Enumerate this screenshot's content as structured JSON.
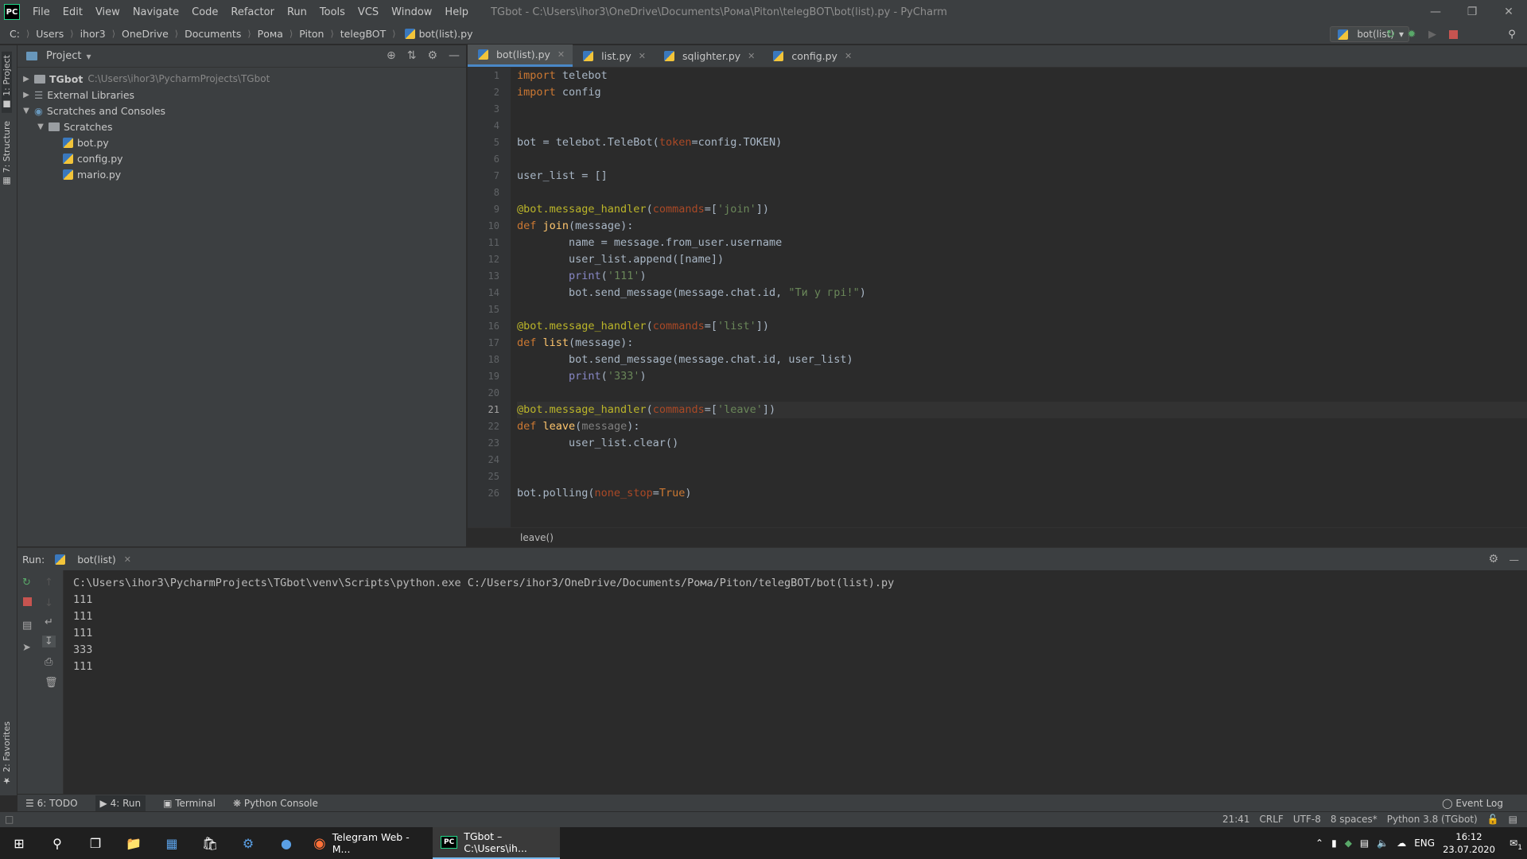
{
  "title_bar": {
    "logo": "PC",
    "menu": [
      "File",
      "Edit",
      "View",
      "Navigate",
      "Code",
      "Refactor",
      "Run",
      "Tools",
      "VCS",
      "Window",
      "Help"
    ],
    "window_title": "TGbot - C:\\Users\\ihor3\\OneDrive\\Documents\\Рома\\Piton\\telegBOT\\bot(list).py - PyCharm"
  },
  "breadcrumbs": [
    "C:",
    "Users",
    "ihor3",
    "OneDrive",
    "Documents",
    "Рома",
    "Piton",
    "telegBOT",
    "bot(list).py"
  ],
  "run_config": "bot(list)",
  "side_tabs": {
    "project": "1: Project",
    "structure": "7: Structure",
    "favorites": "2: Favorites"
  },
  "project_panel": {
    "title": "Project",
    "tree": [
      {
        "label": "TGbot",
        "path": "C:\\Users\\ihor3\\PycharmProjects\\TGbot",
        "type": "folder",
        "depth": 0
      },
      {
        "label": "External Libraries",
        "type": "lib",
        "depth": 0
      },
      {
        "label": "Scratches and Consoles",
        "type": "folder",
        "depth": 0
      },
      {
        "label": "Scratches",
        "type": "folder",
        "depth": 1
      },
      {
        "label": "bot.py",
        "type": "py",
        "depth": 2
      },
      {
        "label": "config.py",
        "type": "py",
        "depth": 2
      },
      {
        "label": "mario.py",
        "type": "py",
        "depth": 2
      }
    ]
  },
  "editor_tabs": [
    "bot(list).py",
    "list.py",
    "sqlighter.py",
    "config.py"
  ],
  "line_numbers": [
    "1",
    "2",
    "3",
    "4",
    "5",
    "6",
    "7",
    "8",
    "9",
    "10",
    "11",
    "12",
    "13",
    "14",
    "15",
    "16",
    "17",
    "18",
    "19",
    "20",
    "21",
    "22",
    "23",
    "24",
    "25",
    "26"
  ],
  "breadcrumb_hint": "leave()",
  "run_panel": {
    "label": "Run:",
    "tab": "bot(list)",
    "console": [
      "C:\\Users\\ihor3\\PycharmProjects\\TGbot\\venv\\Scripts\\python.exe C:/Users/ihor3/OneDrive/Documents/Рома/Piton/telegBOT/bot(list).py",
      "111",
      "111",
      "111",
      "333",
      "111"
    ]
  },
  "bottom_tabs": [
    "6: TODO",
    "4: Run",
    "Terminal",
    "Python Console"
  ],
  "event_log": "Event Log",
  "status": {
    "position": "21:41",
    "line_sep": "CRLF",
    "encoding": "UTF-8",
    "indent": "8 spaces*",
    "interpreter": "Python 3.8 (TGbot)"
  },
  "taskbar": {
    "apps": [
      "Telegram Web - M...",
      "TGbot – C:\\Users\\ih..."
    ],
    "lang": "ENG",
    "time": "16:12",
    "date": "23.07.2020",
    "notifications": "1"
  },
  "colors": {
    "accent": "#4a88c7",
    "keyword": "#cc7832",
    "string": "#6a8759",
    "decorator": "#bbb529"
  }
}
